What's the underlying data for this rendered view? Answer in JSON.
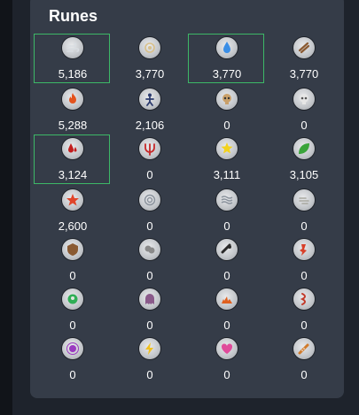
{
  "panel": {
    "title": "Runes"
  },
  "runes": [
    {
      "name": "air-rune",
      "count": "5,186",
      "selected": true,
      "color": "#d8dde2"
    },
    {
      "name": "mind-rune",
      "count": "3,770",
      "selected": false,
      "color": "#d8c08a"
    },
    {
      "name": "water-rune",
      "count": "3,770",
      "selected": true,
      "color": "#3a8ee6"
    },
    {
      "name": "earth-rune",
      "count": "3,770",
      "selected": false,
      "color": "#8a5a32"
    },
    {
      "name": "fire-rune",
      "count": "5,288",
      "selected": false,
      "color": "#e3531e"
    },
    {
      "name": "body-rune",
      "count": "2,106",
      "selected": false,
      "color": "#2d3c6e"
    },
    {
      "name": "death-rune",
      "count": "0",
      "selected": false,
      "color": "#c9a06a"
    },
    {
      "name": "skull-rune",
      "count": "0",
      "selected": false,
      "color": "#e6e6e6"
    },
    {
      "name": "blood-rune",
      "count": "3,124",
      "selected": true,
      "color": "#c21e1e"
    },
    {
      "name": "chaos-rune",
      "count": "0",
      "selected": false,
      "color": "#c62828"
    },
    {
      "name": "cosmic-rune",
      "count": "3,111",
      "selected": false,
      "color": "#f3d21c"
    },
    {
      "name": "nature-rune",
      "count": "3,105",
      "selected": false,
      "color": "#3aa43a"
    },
    {
      "name": "star-rune",
      "count": "2,600",
      "selected": false,
      "color": "#e0452a"
    },
    {
      "name": "swirl-rune",
      "count": "0",
      "selected": false,
      "color": "#8a929c"
    },
    {
      "name": "wave-rune",
      "count": "0",
      "selected": false,
      "color": "#8a929c"
    },
    {
      "name": "mist-rune",
      "count": "0",
      "selected": false,
      "color": "#a8a8a0"
    },
    {
      "name": "shield-rune",
      "count": "0",
      "selected": false,
      "color": "#8a5a32"
    },
    {
      "name": "dust-rune",
      "count": "0",
      "selected": false,
      "color": "#8a8a8a"
    },
    {
      "name": "steam-rune",
      "count": "0",
      "selected": false,
      "color": "#2a2a2a"
    },
    {
      "name": "flame-rune",
      "count": "0",
      "selected": false,
      "color": "#d8402a"
    },
    {
      "name": "soul-rune",
      "count": "0",
      "selected": false,
      "color": "#2fae55"
    },
    {
      "name": "ghost-rune",
      "count": "0",
      "selected": false,
      "color": "#8a5a8a"
    },
    {
      "name": "lava-rune",
      "count": "0",
      "selected": false,
      "color": "#e0601e"
    },
    {
      "name": "mud-rune",
      "count": "0",
      "selected": false,
      "color": "#c23a2a"
    },
    {
      "name": "astral-rune",
      "count": "0",
      "selected": false,
      "color": "#9a3ac0"
    },
    {
      "name": "lightning-rune",
      "count": "0",
      "selected": false,
      "color": "#f0c020"
    },
    {
      "name": "heart-rune",
      "count": "0",
      "selected": false,
      "color": "#e04a9a"
    },
    {
      "name": "flute-rune",
      "count": "0",
      "selected": false,
      "color": "#d07a2a"
    }
  ]
}
